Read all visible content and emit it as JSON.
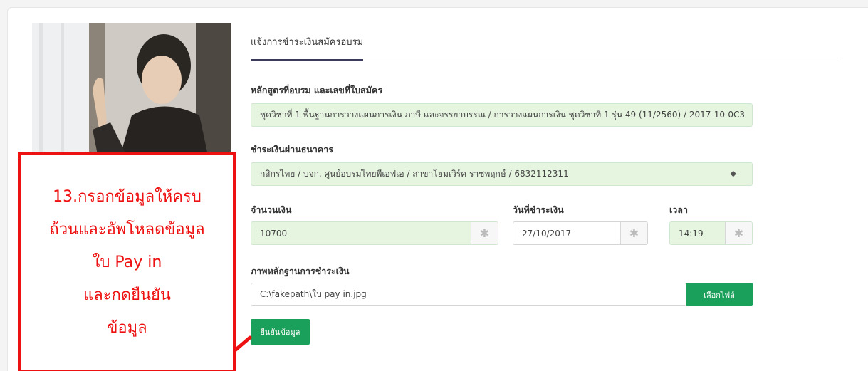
{
  "tab": {
    "active_label": "แจ้งการชำระเงินสมัครอบรม"
  },
  "form": {
    "course_label": "หลักสูตรที่อบรม และเลขที่ใบสมัคร",
    "course_value": "ชุดวิชาที่ 1 พื้นฐานการวางแผนการเงิน ภาษี และจรรยาบรรณ / การวางแผนการเงิน ชุดวิชาที่ 1 รุ่น 49 (11/2560) / 2017-10-0C3",
    "bank_label": "ชำระเงินผ่านธนาคาร",
    "bank_value": "กสิกรไทย / บจก. ศูนย์อบรมไทยพีเอฟเอ / สาขาโฮมเวิร์ค ราชพฤกษ์ / 6832112311",
    "amount_label": "จำนวนเงิน",
    "amount_value": "10700",
    "date_label": "วันที่ชำระเงิน",
    "date_value": "27/10/2017",
    "time_label": "เวลา",
    "time_value": "14:19",
    "evidence_label": "ภาพหลักฐานการชำระเงิน",
    "file_value": "C:\\fakepath\\ใบ pay in.jpg",
    "choose_file_label": "เลือกไฟล์",
    "submit_label": "ยืนยันข้อมูล"
  },
  "callout": {
    "lines": [
      "13.กรอกข้อมูลให้ครบ",
      "ถ้วนและอัพโหลดข้อมูล",
      "ใบ Pay in",
      "และกดยืนยัน",
      "ข้อมูล"
    ]
  },
  "icons": {
    "addon_icon": "asterisk-icon",
    "select_icon": "sort-caret-icon"
  },
  "colors": {
    "field_bg": "#e6f5e0",
    "accent_green": "#1aa05a",
    "callout_red": "#ee1111",
    "tab_underline": "#3a3a5c"
  }
}
